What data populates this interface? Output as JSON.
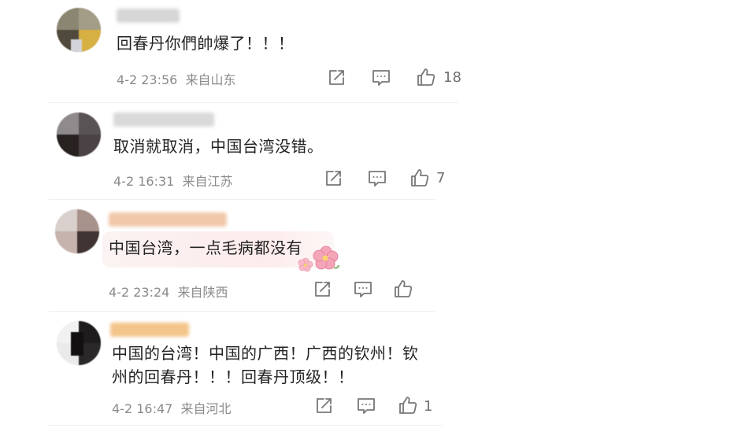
{
  "comments": [
    {
      "text": "回春丹你們帥爆了！！！",
      "time": "4-2 23:56",
      "location": "来自山东",
      "likes": "18"
    },
    {
      "text": "取消就取消，中国台湾没错。",
      "time": "4-2 16:31",
      "location": "来自江苏",
      "likes": "7"
    },
    {
      "text": "中国台湾，一点毛病都没有",
      "time": "4-2 23:24",
      "location": "来自陕西",
      "likes": ""
    },
    {
      "text_line1": "中国的台湾！中国的广西！广西的钦州！钦",
      "text_line2": "州的回春丹！！！回春丹顶级！！",
      "time": "4-2 16:47",
      "location": "来自河北",
      "likes": "1"
    }
  ],
  "icons": {
    "share": "share-icon",
    "reply": "comment-icon",
    "like": "thumbs-up-icon"
  }
}
